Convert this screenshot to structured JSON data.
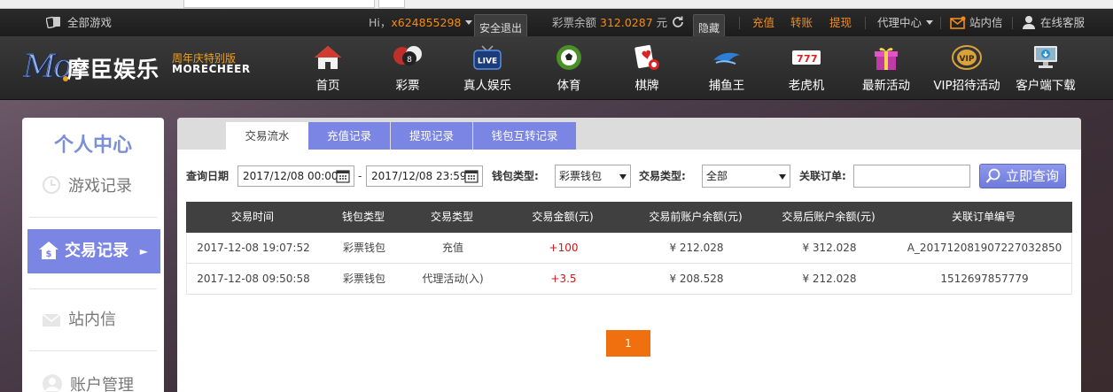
{
  "topbar": {
    "all_games": "全部游戏",
    "greeting": "Hi，",
    "username": "x624855298",
    "logout": "安全退出",
    "balance_label": "彩票余额",
    "balance_amount": "312.0287",
    "balance_unit": "元",
    "hide": "隐藏",
    "recharge": "充值",
    "transfer": "转账",
    "withdraw": "提现",
    "agent_center": "代理中心",
    "inbox": "站内信",
    "online_service": "在线客服"
  },
  "brand": {
    "logo_mark": "Mo",
    "name": "摩臣娱乐",
    "tagline": "周年庆特别版",
    "english": "MORECHEER"
  },
  "nav": {
    "items": [
      {
        "label": "首页",
        "icon": "home-icon"
      },
      {
        "label": "彩票",
        "icon": "lottery-balls-icon"
      },
      {
        "label": "真人娱乐",
        "icon": "live-tv-icon"
      },
      {
        "label": "体育",
        "icon": "soccer-ball-icon"
      },
      {
        "label": "棋牌",
        "icon": "playing-cards-icon"
      },
      {
        "label": "捕鱼王",
        "icon": "fish-icon"
      },
      {
        "label": "老虎机",
        "icon": "slot-machine-icon"
      },
      {
        "label": "最新活动",
        "icon": "gift-box-icon"
      },
      {
        "label": "VIP招待活动",
        "icon": "vip-badge-icon"
      },
      {
        "label": "客户端下载",
        "icon": "download-client-icon"
      }
    ]
  },
  "sidebar": {
    "title": "个人中心",
    "items": [
      {
        "label": "游戏记录",
        "icon": "clock-icon"
      },
      {
        "label": "交易记录",
        "icon": "transaction-house-icon",
        "arrow": "►"
      },
      {
        "label": "站内信",
        "icon": "envelope-icon"
      },
      {
        "label": "账户管理",
        "icon": "user-icon"
      }
    ]
  },
  "tabs": {
    "items": [
      {
        "label": "交易流水"
      },
      {
        "label": "充值记录"
      },
      {
        "label": "提现记录"
      },
      {
        "label": "钱包互转记录"
      }
    ]
  },
  "filters": {
    "date_label": "查询日期",
    "date_from": "2017/12/08 00:00",
    "dash": "-",
    "date_to": "2017/12/08 23:59",
    "wallet_label": "钱包类型:",
    "wallet_value": "彩票钱包",
    "type_label": "交易类型:",
    "type_value": "全部",
    "order_label": "关联订单:",
    "order_value": "",
    "search_button": "立即查询"
  },
  "table": {
    "headers": [
      "交易时间",
      "钱包类型",
      "交易类型",
      "交易金额(元)",
      "交易前账户余额(元)",
      "交易后账户余额(元)",
      "关联订单编号"
    ],
    "rows": [
      [
        "2017-12-08 19:07:52",
        "彩票钱包",
        "充值",
        "+100",
        "¥ 212.028",
        "¥ 312.028",
        "A_20171208190722703285​0"
      ],
      [
        "2017-12-08 09:50:58",
        "彩票钱包",
        "代理活动(入)",
        "+3.5",
        "¥ 208.528",
        "¥ 212.028",
        "1512697857779"
      ]
    ]
  },
  "pagination": {
    "current_page": "1"
  },
  "colors": {
    "accent": "#7b86e4",
    "orange": "#f08c1a",
    "page_button": "#f07010",
    "amount_positive": "#d01818"
  }
}
